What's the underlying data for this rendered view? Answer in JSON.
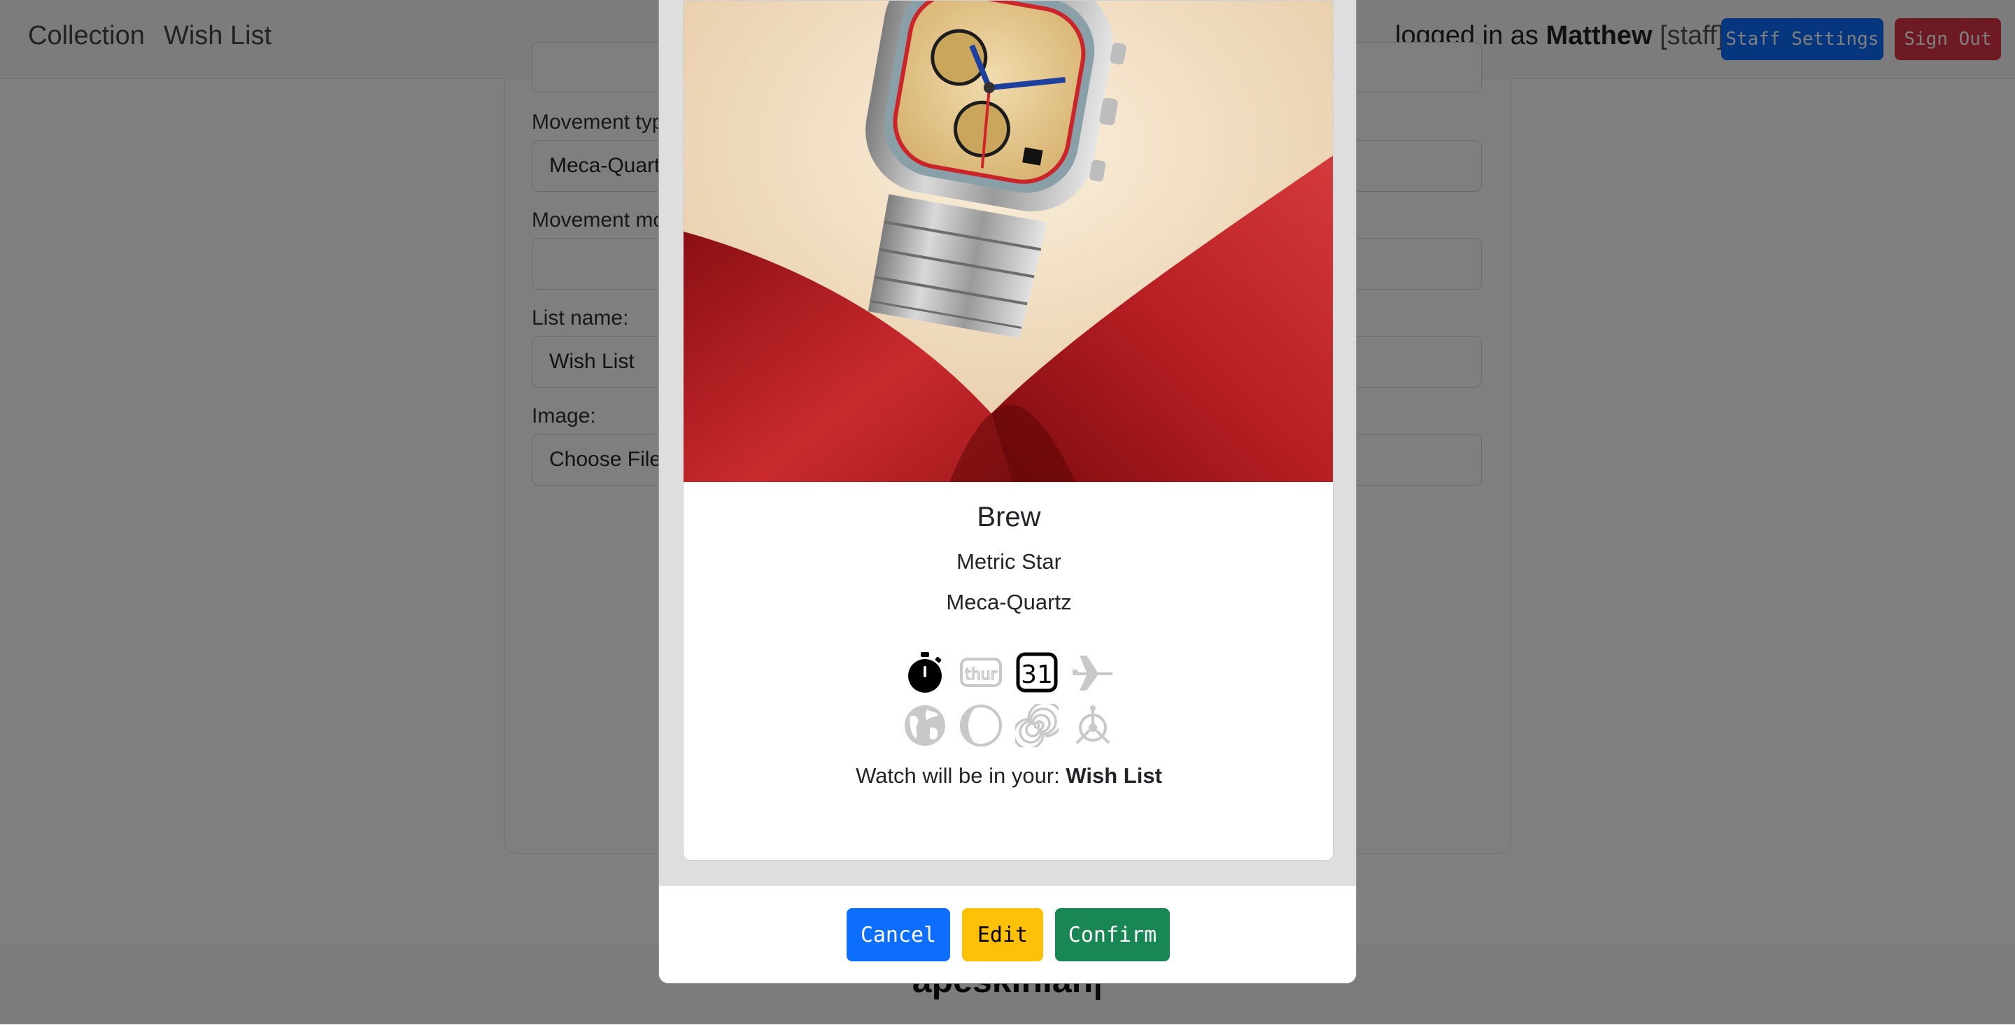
{
  "navbar": {
    "links": [
      "Collection",
      "Wish List"
    ],
    "logged_in_prefix": "logged in as",
    "username": "Matthew",
    "role": "[staff]",
    "staff_settings_label": "Staff Settings",
    "sign_out_label": "Sign Out"
  },
  "form": {
    "movement_type_label": "Movement type:",
    "movement_type_value": "Meca-Quartz",
    "movement_model_label": "Movement model:",
    "movement_model_value": "",
    "list_name_label": "List name:",
    "list_name_value": "Wish List",
    "image_label": "Image:",
    "image_button": "Choose File"
  },
  "footer": {
    "brand": "apeskinian|"
  },
  "modal": {
    "brand": "Brew",
    "model": "Metric Star",
    "movement": "Meca-Quartz",
    "list_prefix": "Watch will be in your:",
    "list_name": "Wish List",
    "features": [
      {
        "icon": "stopwatch-icon",
        "active": true
      },
      {
        "icon": "day-thur-icon",
        "label": "thur",
        "active": false
      },
      {
        "icon": "date-31-icon",
        "label": "31",
        "active": true
      },
      {
        "icon": "airplane-icon",
        "active": false
      },
      {
        "icon": "globe-icon",
        "active": false
      },
      {
        "icon": "moon-phase-icon",
        "active": false
      },
      {
        "icon": "spiral-icon",
        "active": false
      },
      {
        "icon": "tourbillon-icon",
        "active": false
      }
    ],
    "buttons": {
      "cancel": "Cancel",
      "edit": "Edit",
      "confirm": "Confirm"
    }
  },
  "colors": {
    "primary": "#0d6efd",
    "warning": "#ffc107",
    "success": "#198754",
    "danger": "#dc3545",
    "inactive_icon": "#c8c8c8"
  }
}
